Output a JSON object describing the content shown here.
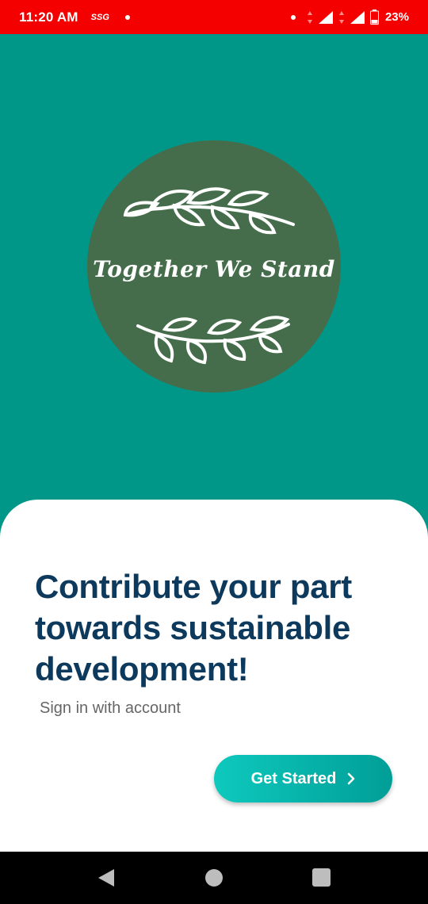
{
  "status_bar": {
    "time": "11:20 AM",
    "carrier": "SSG",
    "battery": "23%"
  },
  "logo": {
    "text": "Together We Stand"
  },
  "card": {
    "headline": [
      "Contribute your part",
      "towards sustainable",
      "development!"
    ],
    "subtitle": "Sign in with account",
    "cta_label": "Get Started",
    "cta_icon": "chevron-right-icon"
  },
  "nav_bar": {
    "buttons": [
      "back-icon",
      "home-icon",
      "recents-icon"
    ]
  },
  "colors": {
    "status_bar": "#f50000",
    "hero_background": "#009688",
    "logo_circle": "#456d4b",
    "headline": "#0d3a5c",
    "cta_gradient_start": "#0ec9bd",
    "cta_gradient_end": "#009e97"
  }
}
